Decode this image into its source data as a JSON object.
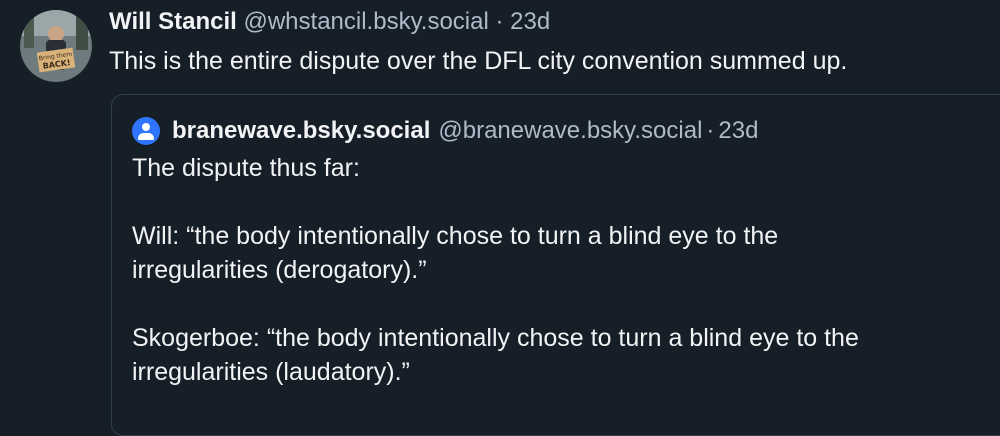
{
  "post": {
    "author_name": "Will Stancil",
    "author_handle": "@whstancil.bsky.social",
    "separator": "·",
    "timestamp": "23d",
    "text": "This is the entire dispute over the DFL city convention summed up.",
    "avatar_sign_text": "Bring them BACK!"
  },
  "quote": {
    "author_name": "branewave.bsky.social",
    "author_handle": "@branewave.bsky.social",
    "separator": "·",
    "timestamp": "23d",
    "lines": [
      "The dispute thus far:",
      "",
      "Will: “the body intentionally chose to turn a blind eye to the",
      "irregularities (derogatory).”",
      "",
      "Skogerboe: “the body intentionally chose to turn a blind eye to the",
      "irregularities (laudatory).”"
    ]
  },
  "colors": {
    "background": "#161e27",
    "text": "#f1f3f5",
    "muted": "#aebbc9",
    "border": "#2e4052",
    "default_avatar": "#2f74ff"
  }
}
